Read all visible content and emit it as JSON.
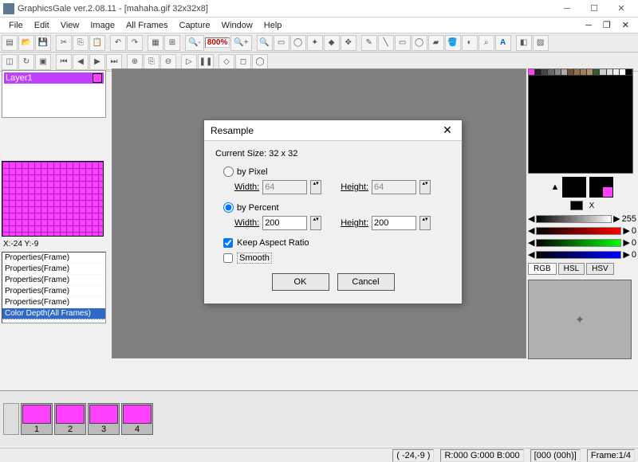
{
  "window": {
    "title": "GraphicsGale ver.2.08.11 - [mahaha.gif 32x32x8]"
  },
  "menu": [
    "File",
    "Edit",
    "View",
    "Image",
    "All Frames",
    "Capture",
    "Window",
    "Help"
  ],
  "zoom": "800%",
  "left": {
    "layer_label": "Layer1",
    "coord": "X:-24 Y:-9",
    "history": [
      "Properties(Frame)",
      "Properties(Frame)",
      "Properties(Frame)",
      "Properties(Frame)",
      "Properties(Frame)",
      "Color Depth(All Frames)"
    ]
  },
  "right": {
    "grad_value": "255",
    "channel_value": "0",
    "tabs": [
      "RGB",
      "HSL",
      "HSV"
    ]
  },
  "timeline": {
    "frames": [
      "1",
      "2",
      "3",
      "4"
    ]
  },
  "status": {
    "xy": "( -24,-9 )",
    "rgb": "R:000 G:000 B:000",
    "time": "[000 (00h)]",
    "frame": "Frame:1/4"
  },
  "dialog": {
    "title": "Resample",
    "current_size": "Current Size: 32 x 32",
    "by_pixel": "by Pixel",
    "by_percent": "by Percent",
    "width_label": "Width:",
    "height_label": "Height:",
    "px_w": "64",
    "px_h": "64",
    "pc_w": "200",
    "pc_h": "200",
    "keep_aspect": "Keep Aspect Ratio",
    "smooth": "Smooth",
    "ok": "OK",
    "cancel": "Cancel"
  }
}
